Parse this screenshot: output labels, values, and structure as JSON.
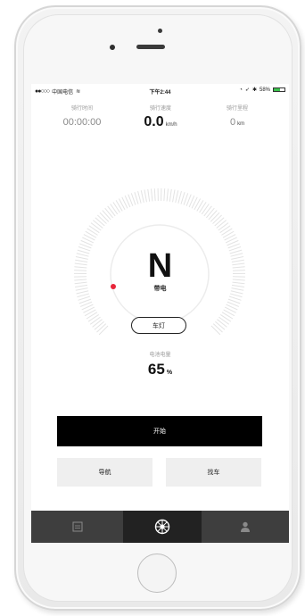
{
  "status_bar": {
    "carrier": "中国电信",
    "time": "下午2:44",
    "battery_percent": "58%"
  },
  "stats": {
    "ride_time_label": "骑行时间",
    "ride_time_value": "00:00:00",
    "speed_label": "骑行速度",
    "speed_value": "0.0",
    "speed_unit": "km/h",
    "distance_label": "骑行里程",
    "distance_value": "0",
    "distance_unit": "km"
  },
  "gauge": {
    "gear": "N",
    "mode": "带电"
  },
  "light_button": "车灯",
  "battery": {
    "label": "电池电量",
    "value": "65",
    "unit": "%"
  },
  "buttons": {
    "start": "开始",
    "navigate": "导航",
    "find_car": "找车"
  },
  "tabs": [
    {
      "icon": "list-icon",
      "active": false
    },
    {
      "icon": "wheel-icon",
      "active": true
    },
    {
      "icon": "user-icon",
      "active": false
    }
  ],
  "colors": {
    "battery_indicator": "#3cc24d",
    "tab_active_bg": "#222222",
    "tab_bg": "#3e3e3e",
    "gauge_marker": "#e8253a"
  }
}
